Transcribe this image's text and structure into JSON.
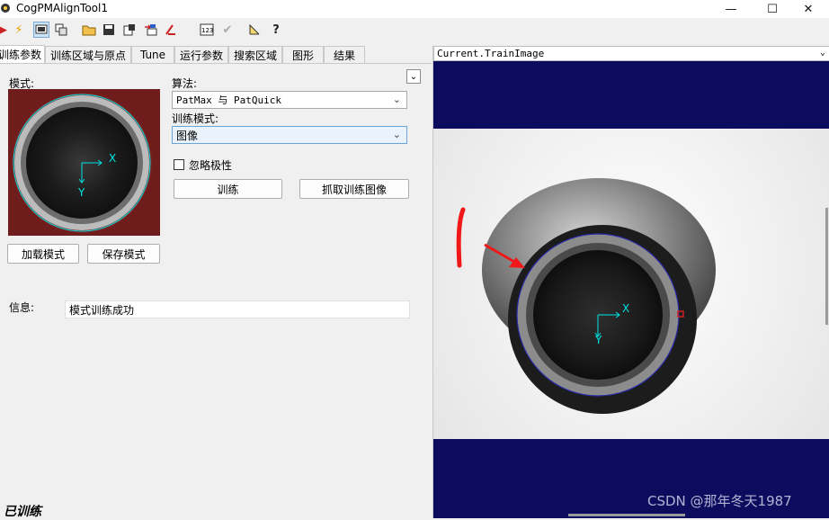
{
  "window": {
    "title": "CogPMAlignTool1",
    "controls": [
      "—",
      "☐",
      "✕"
    ]
  },
  "toolbar": {
    "icons": [
      "run-icon",
      "lightning-icon",
      "display-icon",
      "copy-icon",
      "open-icon",
      "save-icon",
      "export-icon",
      "import-icon",
      "reset-icon",
      "numbers-icon",
      "check-icon",
      "ruler-icon",
      "help-icon"
    ]
  },
  "tabs": [
    "训练参数",
    "训练区域与原点",
    "Tune",
    "运行参数",
    "搜索区域",
    "图形",
    "结果"
  ],
  "train": {
    "mode_label": "模式:",
    "algorithm_label": "算法:",
    "algorithm_value": "PatMax 与 PatQuick",
    "train_mode_label": "训练模式:",
    "train_mode_value": "图像",
    "ignore_polarity_label": "忽略极性",
    "train_button": "训练",
    "grab_button": "抓取训练图像",
    "load_button": "加载模式",
    "save_button": "保存模式",
    "info_label": "信息:",
    "info_value": "模式训练成功",
    "axis_x": "X",
    "axis_y": "Y"
  },
  "viewer": {
    "header": "Current.TrainImage",
    "axis_x": "X",
    "axis_y": "Y",
    "watermark": "CSDN @那年冬天1987"
  },
  "status": "已训练",
  "colors": {
    "background": "#f0f0f0",
    "image_band": "#0c0c5e",
    "accent": "#00e5e5"
  }
}
